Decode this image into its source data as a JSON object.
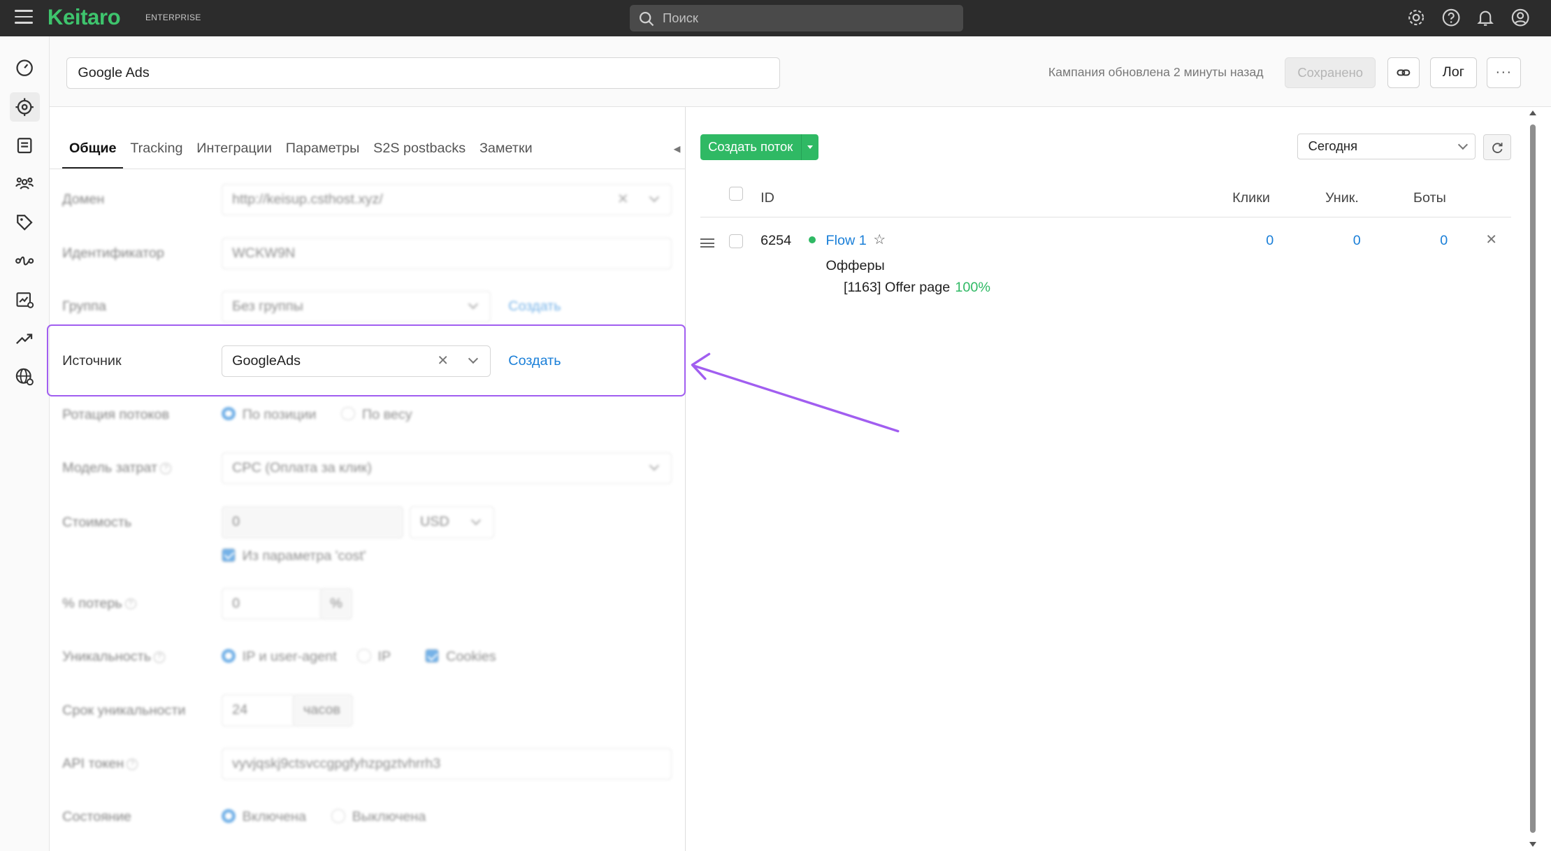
{
  "app": {
    "logo": "Keitaro",
    "edition": "ENTERPRISE",
    "search_placeholder": "Поиск"
  },
  "topbar_icons": [
    "gear-icon",
    "help-icon",
    "bell-icon",
    "user-icon"
  ],
  "sidebar": {
    "items": [
      {
        "icon": "dashboard-icon"
      },
      {
        "icon": "campaigns-icon",
        "active": true
      },
      {
        "icon": "offers-icon"
      },
      {
        "icon": "users-icon"
      },
      {
        "icon": "tag-icon"
      },
      {
        "icon": "flow-icon"
      },
      {
        "icon": "report-settings-icon"
      },
      {
        "icon": "trend-icon"
      },
      {
        "icon": "geo-icon"
      }
    ]
  },
  "header": {
    "campaign_name": "Google Ads",
    "updated_text": "Кампания обновлена 2 минуты назад",
    "saved_label": "Сохранено",
    "log_label": "Лог",
    "more_label": "···"
  },
  "tabs": [
    {
      "label": "Общие",
      "active": true
    },
    {
      "label": "Tracking"
    },
    {
      "label": "Интеграции"
    },
    {
      "label": "Параметры"
    },
    {
      "label": "S2S postbacks"
    },
    {
      "label": "Заметки"
    }
  ],
  "form": {
    "domain": {
      "label": "Домен",
      "value": "http://keisup.csthost.xyz/"
    },
    "identifier": {
      "label": "Идентификатор",
      "value": "WCKW9N"
    },
    "group": {
      "label": "Группа",
      "value": "Без группы",
      "create": "Создать"
    },
    "source": {
      "label": "Источник",
      "value": "GoogleAds",
      "create": "Создать"
    },
    "rotation": {
      "label": "Ротация потоков",
      "opt1": "По позиции",
      "opt2": "По весу"
    },
    "cost_model": {
      "label": "Модель затрат",
      "value": "CPC (Оплата за клик)"
    },
    "cost": {
      "label": "Стоимость",
      "value": "0",
      "currency": "USD",
      "param_label": "Из параметра 'cost'"
    },
    "loss": {
      "label": "% потерь",
      "value": "0",
      "unit": "%"
    },
    "uniqueness": {
      "label": "Уникальность",
      "opt1": "IP и user-agent",
      "opt2": "IP",
      "opt3": "Cookies"
    },
    "uniqueness_ttl": {
      "label": "Срок уникальности",
      "value": "24",
      "unit": "часов"
    },
    "api_token": {
      "label": "API токен",
      "value": "vyvjqskj9ctsvccgpgfyhzpgztvhrrh3"
    },
    "state": {
      "label": "Состояние",
      "opt1": "Включена",
      "opt2": "Выключена"
    }
  },
  "flows": {
    "create_label": "Создать поток",
    "period": "Сегодня",
    "columns": {
      "id": "ID",
      "clicks": "Клики",
      "unique": "Уник.",
      "bots": "Боты"
    },
    "rows": [
      {
        "id": "6254",
        "name": "Flow 1",
        "clicks": "0",
        "unique": "0",
        "bots": "0",
        "offers_label": "Офферы",
        "offer": "[1163] Offer page",
        "share": "100%"
      }
    ]
  },
  "colors": {
    "brand": "#3ec46d",
    "accent": "#1a7fd8",
    "highlight": "#a15ef0",
    "success": "#2fb964"
  }
}
